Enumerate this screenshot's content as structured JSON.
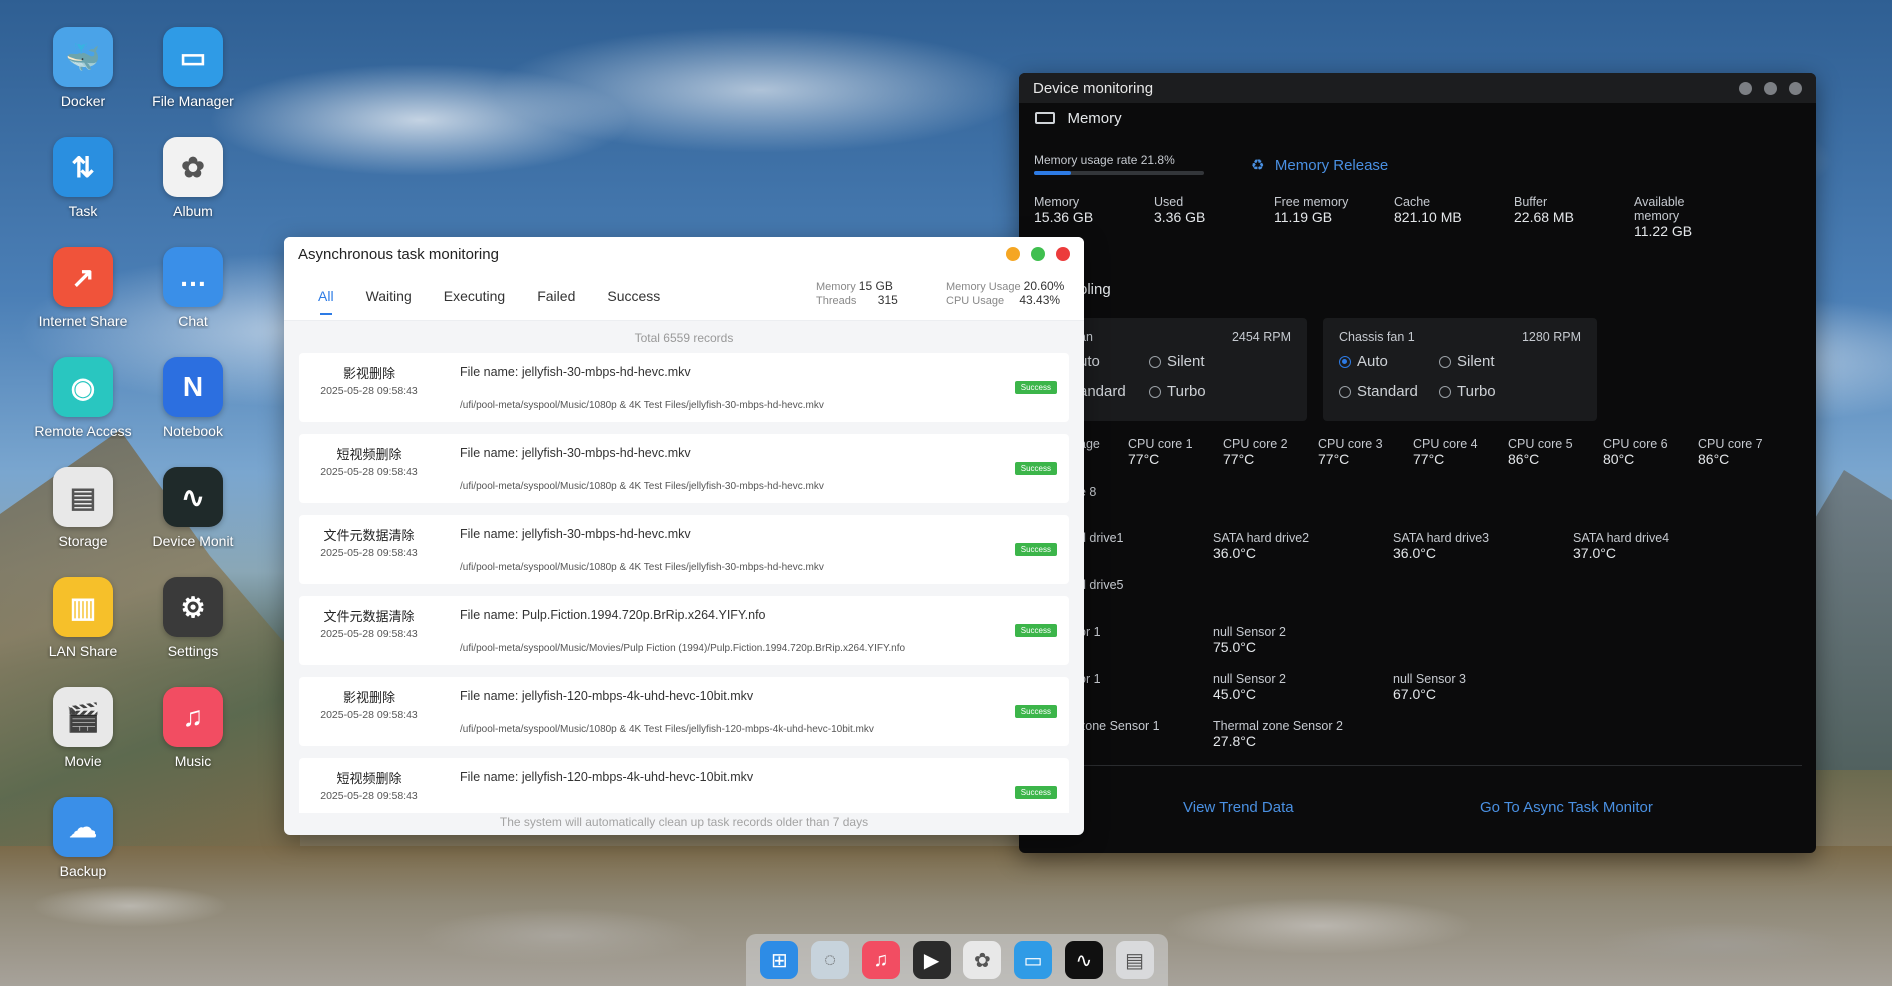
{
  "desktop": {
    "icons": [
      {
        "label": "Docker",
        "glyph": "🐳",
        "color": "#4aa3e8"
      },
      {
        "label": "File Manager",
        "glyph": "▭",
        "color": "#2f9be6"
      },
      {
        "label": "Task",
        "glyph": "⇅",
        "color": "#2a8fe0"
      },
      {
        "label": "Album",
        "glyph": "✿",
        "color": "#f2f2f2"
      },
      {
        "label": "Internet Share",
        "glyph": "↗",
        "color": "#f0533a"
      },
      {
        "label": "Chat",
        "glyph": "…",
        "color": "#3a8fe8"
      },
      {
        "label": "Remote Access",
        "glyph": "◉",
        "color": "#29c6c0"
      },
      {
        "label": "Notebook",
        "glyph": "N",
        "color": "#2c6fe0"
      },
      {
        "label": "Storage",
        "glyph": "▤",
        "color": "#e8e8e8"
      },
      {
        "label": "Device Monit",
        "glyph": "∿",
        "color": "#1f2a2a"
      },
      {
        "label": "LAN Share",
        "glyph": "▥",
        "color": "#f6c02a"
      },
      {
        "label": "Settings",
        "glyph": "⚙",
        "color": "#3a3a3a"
      },
      {
        "label": "Movie",
        "glyph": "🎬",
        "color": "#e8e8e8"
      },
      {
        "label": "Music",
        "glyph": "♫",
        "color": "#f24d62"
      },
      {
        "label": "Backup",
        "glyph": "☁",
        "color": "#3a8fe8"
      }
    ]
  },
  "async": {
    "title": "Asynchronous task monitoring",
    "tabs": [
      "All",
      "Waiting",
      "Executing",
      "Failed",
      "Success"
    ],
    "stats": {
      "memory_label": "Memory",
      "memory_value": "15 GB",
      "threads_label": "Threads",
      "threads_value": "315",
      "mem_usage_label": "Memory Usage",
      "mem_usage_value": "20.60%",
      "cpu_usage_label": "CPU Usage",
      "cpu_usage_value": "43.43%"
    },
    "total": "Total 6559 records",
    "tasks": [
      {
        "name": "影视删除",
        "time": "2025-05-28 09:58:43",
        "file": "File name: jellyfish-30-mbps-hd-hevc.mkv",
        "path": "/ufi/pool-meta/syspool/Music/1080p & 4K Test Files/jellyfish-30-mbps-hd-hevc.mkv",
        "status": "Success"
      },
      {
        "name": "短视频删除",
        "time": "2025-05-28 09:58:43",
        "file": "File name: jellyfish-30-mbps-hd-hevc.mkv",
        "path": "/ufi/pool-meta/syspool/Music/1080p & 4K Test Files/jellyfish-30-mbps-hd-hevc.mkv",
        "status": "Success"
      },
      {
        "name": "文件元数据清除",
        "time": "2025-05-28 09:58:43",
        "file": "File name: jellyfish-30-mbps-hd-hevc.mkv",
        "path": "/ufi/pool-meta/syspool/Music/1080p & 4K Test Files/jellyfish-30-mbps-hd-hevc.mkv",
        "status": "Success"
      },
      {
        "name": "文件元数据清除",
        "time": "2025-05-28 09:58:43",
        "file": "File name: Pulp.Fiction.1994.720p.BrRip.x264.YIFY.nfo",
        "path": "/ufi/pool-meta/syspool/Music/Movies/Pulp Fiction (1994)/Pulp.Fiction.1994.720p.BrRip.x264.YIFY.nfo",
        "status": "Success"
      },
      {
        "name": "影视删除",
        "time": "2025-05-28 09:58:43",
        "file": "File name: jellyfish-120-mbps-4k-uhd-hevc-10bit.mkv",
        "path": "/ufi/pool-meta/syspool/Music/1080p & 4K Test Files/jellyfish-120-mbps-4k-uhd-hevc-10bit.mkv",
        "status": "Success"
      },
      {
        "name": "短视频删除",
        "time": "2025-05-28 09:58:43",
        "file": "File name: jellyfish-120-mbps-4k-uhd-hevc-10bit.mkv",
        "path": "",
        "status": "Success"
      }
    ],
    "footer": "The system will automatically clean up task records older than 7 days"
  },
  "device": {
    "title": "Device monitoring",
    "memory": {
      "section": "Memory",
      "usage_rate": "Memory usage rate 21.8%",
      "usage_fraction": 0.218,
      "release": "Memory Release",
      "stats": [
        {
          "label": "Memory",
          "value": "15.36 GB"
        },
        {
          "label": "Used",
          "value": "3.36 GB"
        },
        {
          "label": "Free memory",
          "value": "11.19 GB"
        },
        {
          "label": "Cache",
          "value": "821.10 MB"
        },
        {
          "label": "Buffer",
          "value": "22.68 MB"
        },
        {
          "label": "Available",
          "label2": "memory",
          "value": "11.22 GB"
        }
      ]
    },
    "cooling": {
      "section_partial": "oling",
      "fan_a": {
        "name_partial": "an",
        "rpm": "2454 RPM",
        "opt_auto": "uto",
        "opt_silent": "Silent",
        "opt_standard": "andard",
        "opt_turbo": "Turbo"
      },
      "fan_b": {
        "name": "Chassis fan 1",
        "rpm": "1280 RPM",
        "opt_auto": "Auto",
        "opt_silent": "Silent",
        "opt_standard": "Standard",
        "opt_turbo": "Turbo"
      }
    },
    "cpu": {
      "partial_label": "age",
      "partial_label2": "e 8",
      "cores": [
        {
          "label": "CPU core 1",
          "value": "77°C"
        },
        {
          "label": "CPU core 2",
          "value": "77°C"
        },
        {
          "label": "CPU core 3",
          "value": "77°C"
        },
        {
          "label": "CPU core 4",
          "value": "77°C"
        },
        {
          "label": "CPU core 5",
          "value": "86°C"
        },
        {
          "label": "CPU core 6",
          "value": "80°C"
        },
        {
          "label": "CPU core 7",
          "value": "86°C"
        }
      ]
    },
    "drives": {
      "partial1": "d drive1",
      "partial5": "d drive5",
      "items": [
        {
          "label": "SATA hard drive2",
          "value": "36.0°C"
        },
        {
          "label": "SATA hard drive3",
          "value": "36.0°C"
        },
        {
          "label": "SATA hard drive4",
          "value": "37.0°C"
        }
      ]
    },
    "sensors": {
      "partial_a": "or 1",
      "partial_b": "or 1",
      "partial_c": "zone  Sensor 1",
      "row1": {
        "label": "null Sensor 2",
        "value": "75.0°C"
      },
      "row2": [
        {
          "label": "null Sensor 2",
          "value": "45.0°C"
        },
        {
          "label": "null Sensor 3",
          "value": "67.0°C"
        }
      ],
      "row3": {
        "label": "Thermal zone  Sensor 2",
        "value": "27.8°C"
      }
    },
    "links": {
      "trend": "View Trend Data",
      "async": "Go To Async Task Monitor"
    }
  },
  "dock": {
    "items": [
      {
        "name": "launcher",
        "glyph": "⊞",
        "color": "#2d8ce6"
      },
      {
        "name": "storage",
        "glyph": "◌",
        "color": "#c7d3dc"
      },
      {
        "name": "music",
        "glyph": "♫",
        "color": "#f24d62"
      },
      {
        "name": "movie",
        "glyph": "▶",
        "color": "#2b2b2b"
      },
      {
        "name": "album",
        "glyph": "✿",
        "color": "#e8e8e8"
      },
      {
        "name": "files",
        "glyph": "▭",
        "color": "#2f9be6"
      },
      {
        "name": "device-monitor",
        "glyph": "∿",
        "color": "#101010"
      },
      {
        "name": "task-monitor",
        "glyph": "▤",
        "color": "#d9dadc"
      }
    ]
  }
}
